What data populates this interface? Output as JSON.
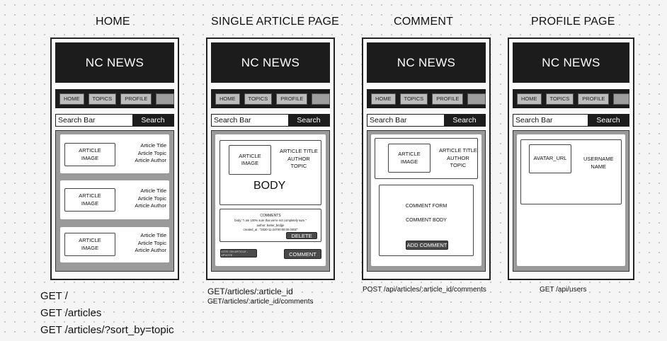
{
  "screens": [
    {
      "title": "HOME"
    },
    {
      "title": "SINGLE ARTICLE PAGE"
    },
    {
      "title": "COMMENT"
    },
    {
      "title": "PROFILE PAGE"
    }
  ],
  "common": {
    "header": "NC NEWS",
    "nav": [
      "HOME",
      "TOPICS",
      "PROFILE"
    ],
    "search_placeholder": "Search Bar",
    "search_button": "Search"
  },
  "home": {
    "cards": [
      {
        "image": "ARTICLE\nIMAGE",
        "meta": "Article Title\nArticle Topic\nArticle Author"
      },
      {
        "image": "ARTICLE\nIMAGE",
        "meta": "Article Title\nArticle Topic\nArticle Author"
      },
      {
        "image": "ARTICLE\nIMAGE",
        "meta": "Article Title\nArticle Topic\nArticle Author"
      }
    ]
  },
  "article": {
    "image": "ARTICLE\nIMAGE",
    "meta": "ARTICLE TITLE\nAUTHOR\nTOPIC",
    "body": "BODY",
    "comments_heading": "COMMENTS",
    "comment_text": "body: \"I am 100% sure that we're not completely sure.\"\nauthor: butter_bridge\ncreated_at : \"2020-11-24T00:08:00.000Z\"",
    "delete_button": "DELETE",
    "vote_button": "VOTE ON ARTICLE - UPVOTE",
    "comment_button": "COMMENT"
  },
  "comment": {
    "image": "ARTICLE\nIMAGE",
    "meta": "ARTICLE TITLE\nAUTHOR\nTOPIC",
    "form_label": "COMMENT FORM",
    "body_label": "COMMENT BODY",
    "add_button": "ADD COMMENT"
  },
  "profile": {
    "avatar": "AVATAR_URL",
    "meta": "USERNAME\nNAME"
  },
  "endpoints": {
    "home": [
      "GET /",
      "GET /articles",
      "GET /articles/?sort_by=topic"
    ],
    "article": [
      "GET/articles/:article_id",
      "GET/articles/:article_id/comments"
    ],
    "comment": [
      "POST /api/articles/:article_id/comments"
    ],
    "profile": [
      "GET /api/users"
    ]
  }
}
